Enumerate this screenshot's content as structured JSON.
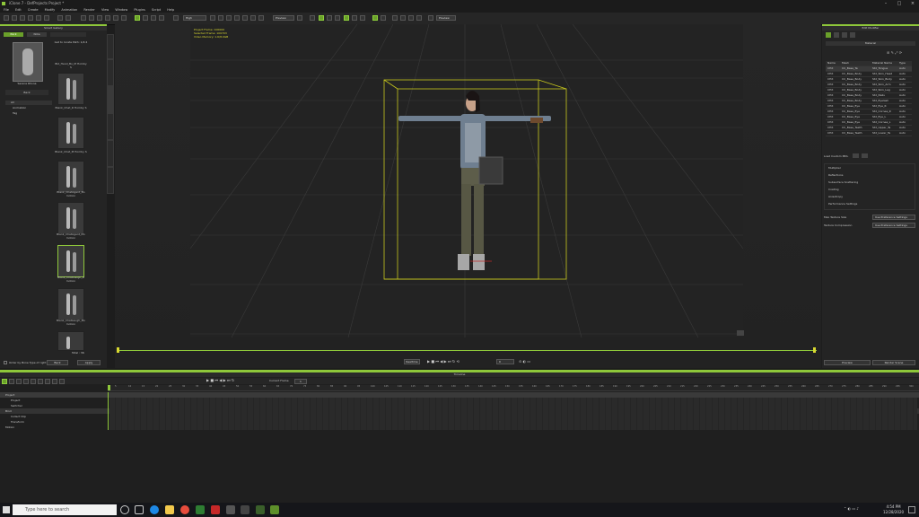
{
  "app": {
    "title": "iClone 7 - DefProjects Project *"
  },
  "menu": [
    "File",
    "Edit",
    "Create",
    "Modify",
    "Animation",
    "Render",
    "View",
    "Window",
    "Plugins",
    "Script",
    "Help"
  ],
  "toolbar": {
    "quality": "High",
    "preview": "Preview",
    "perf": "Preview"
  },
  "left_panel": {
    "title": "Smart Gallery",
    "tabs": [
      "Pack",
      "Note"
    ],
    "path": "Get to locate Path: 1/4:4",
    "avatar_label": "Serena Rhona",
    "back_label": "Back",
    "tree": [
      "All",
      "Animation",
      "Tag"
    ],
    "items": [
      "Bld_Hand_Bo_M Homby S",
      "Blank_Chat_R Homby S",
      "Blank_Chat_M Homby S",
      "Blank_ChatAgent_Bo motion",
      "Blank_ChatAgent_Mo motion",
      "Blank_ChatLaugh_R motion",
      "Blank_ChatLaugh_Mo motion"
    ],
    "count": "Total : 36",
    "checkbox_label": "Order by Bone Type of right",
    "apply": "Apply",
    "back2": "Back"
  },
  "side_tabs": [
    "Hub",
    "Smart Gallery",
    "Apply",
    "Scene",
    "Visual",
    "Tools"
  ],
  "viewport": {
    "stats": [
      "Project Frame: 100000",
      "Selected Frame: 100703",
      "Video Memory: 1.6/8.0GB"
    ]
  },
  "playback": {
    "realtime": "Realtime",
    "frame": "0"
  },
  "right_panel": {
    "title": "Edit Modifier",
    "section": "Material",
    "headers": [
      "Name",
      "Mesh",
      "Material Name",
      "Type"
    ],
    "rows": [
      [
        "CHX",
        "CC_Base_Te",
        "Std_Tongue",
        "Auto"
      ],
      [
        "CHX",
        "CC_Base_Body",
        "Std_Skin_Head",
        "Auto"
      ],
      [
        "CHX",
        "CC_Base_Body",
        "Std_Skin_Body",
        "Auto"
      ],
      [
        "CHX",
        "CC_Base_Body",
        "Std_Skin_Arm",
        "Auto"
      ],
      [
        "CHX",
        "CC_Base_Body",
        "Std_Skin_Leg",
        "Auto"
      ],
      [
        "CHX",
        "CC_Base_Body",
        "Std_Nails",
        "Auto"
      ],
      [
        "CHX",
        "CC_Base_Body",
        "Std_Eyelash",
        "Auto"
      ],
      [
        "CHX",
        "CC_Base_Eye",
        "Std_Eye_R",
        "Auto"
      ],
      [
        "CHX",
        "CC_Base_Eye",
        "Std_Cornea_R",
        "Auto"
      ],
      [
        "CHX",
        "CC_Base_Eye",
        "Std_Eye_L",
        "Auto"
      ],
      [
        "CHX",
        "CC_Base_Eye",
        "Std_Cornea_L",
        "Auto"
      ],
      [
        "CHX",
        "CC_Base_Teeth",
        "Std_Upper_Te",
        "Auto"
      ],
      [
        "CHX",
        "CC_Base_Teeth",
        "Std_Lower_Te",
        "Auto"
      ]
    ],
    "load_label": "Load Custom MDL",
    "sections": [
      "Multiplier",
      "Reflections",
      "Subsurface Scattering",
      "Coating",
      "Anisotropy",
      "Performance Settings"
    ],
    "max_texture_label": "Max Texture Size",
    "max_texture_value": "Use Preference Settings",
    "compression_label": "Texture Compression",
    "compression_value": "Use Preference Settings",
    "preview_btn": "Preview",
    "render_btn": "Render Scene"
  },
  "timeline": {
    "title": "Timeline",
    "current_frame_label": "Current Frame",
    "current_frame": "1",
    "ticks": [
      "5",
      "10",
      "15",
      "20",
      "25",
      "30",
      "35",
      "40",
      "45",
      "50",
      "55",
      "60",
      "65",
      "70",
      "75",
      "80",
      "85",
      "90",
      "95",
      "100",
      "105",
      "110",
      "115",
      "120",
      "125",
      "130",
      "135",
      "140",
      "145",
      "150",
      "155",
      "160",
      "165",
      "170",
      "175",
      "180",
      "185",
      "190",
      "195",
      "200",
      "205",
      "210",
      "215",
      "220",
      "225",
      "230",
      "235",
      "240",
      "245",
      "250",
      "255",
      "260",
      "265",
      "270",
      "275",
      "280",
      "285",
      "290",
      "295",
      "300"
    ],
    "tracks": [
      "Project",
      "Project",
      "Switcher",
      "Bind",
      "Collect Clip",
      "Transform",
      "Motion"
    ]
  },
  "taskbar": {
    "search": "Type here to search",
    "time": "4:54 PM",
    "date": "12/28/2020"
  }
}
